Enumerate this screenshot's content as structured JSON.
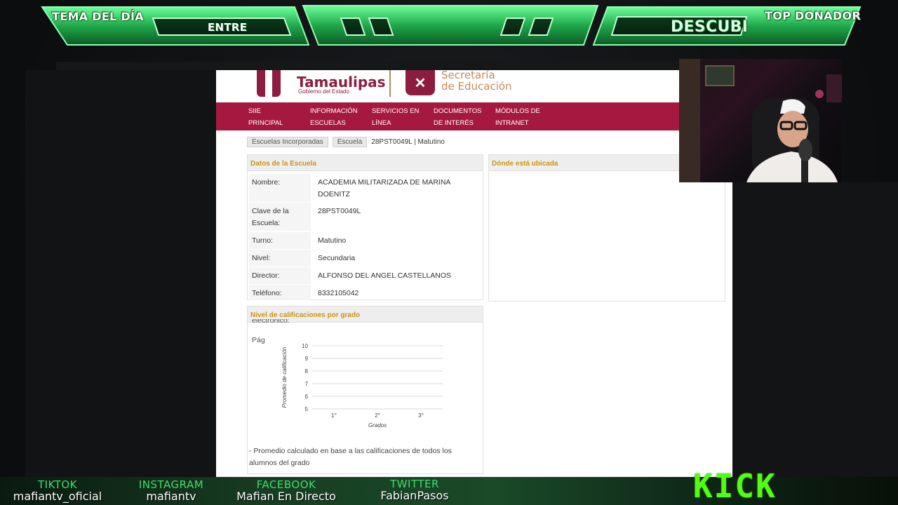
{
  "overlay": {
    "tema_label": "TEMA DEL DÍA",
    "tema_value": "ENTRE",
    "donador_label": "TOP DONADOR",
    "donador_value": "DESCUBI",
    "accent_color": "#2bd45a"
  },
  "site": {
    "logo_name": "Tamaulipas",
    "logo_sub": "Gobierno del Estado",
    "sep_line1": "Secretaría",
    "sep_line2": "de Educación",
    "brand_color": "#a6193e"
  },
  "nav": [
    {
      "line1": "SIIE",
      "line2": "PRINCIPAL"
    },
    {
      "line1": "INFORMACIÓN",
      "line2": "ESCUELAS"
    },
    {
      "line1": "SERVICIOS EN",
      "line2": "LÍNEA"
    },
    {
      "line1": "DOCUMENTOS",
      "line2": "DE INTERÉS"
    },
    {
      "line1": "MÓDULOS DE",
      "line2": "INTRANET"
    }
  ],
  "breadcrumb": {
    "items": [
      "Escuelas Incorporadas",
      "Escuela"
    ],
    "current": "28PST0049L | Matutino"
  },
  "datos": {
    "title": "Datos de la Escuela",
    "rows": [
      {
        "label": "Nombre:",
        "value": "ACADEMIA MILITARIZADA DE MARINA DOENITZ"
      },
      {
        "label": "Clave de la Escuela:",
        "value": "28PST0049L"
      },
      {
        "label": "Turno:",
        "value": "Matutino"
      },
      {
        "label": "Nivel:",
        "value": "Secundaria"
      },
      {
        "label": "Director:",
        "value": "ALFONSO DEL ANGEL CASTELLANOS"
      },
      {
        "label": "Teléfono:",
        "value": "8332105042"
      }
    ]
  },
  "ubicada": {
    "title": "Dónde está ubicada"
  },
  "calificaciones": {
    "title": "Nivel de calificaciones por grado",
    "overflow_text_1": "electrónico:",
    "overflow_text_2": "Pág",
    "note": "- Promedio calculado en base a las calificaciones de todos los alumnos del grado"
  },
  "chart_data": {
    "type": "bar",
    "categories": [
      "1°",
      "2°",
      "3°"
    ],
    "values": [],
    "xlabel": "Grados",
    "ylabel": "Promedio de calificación",
    "ylim": [
      5,
      10
    ],
    "yticks": [
      "5",
      "6",
      "7",
      "8",
      "9",
      "10"
    ],
    "grid": true
  },
  "social": [
    {
      "network": "TIKTOK",
      "handle": "mafiantv_oficial"
    },
    {
      "network": "INSTAGRAM",
      "handle": "mafiantv"
    },
    {
      "network": "FACEBOOK",
      "handle": "Mafian En Directo"
    },
    {
      "network": "TWITTER",
      "handle": "FabianPasos"
    }
  ],
  "kick_logo": "KICK"
}
